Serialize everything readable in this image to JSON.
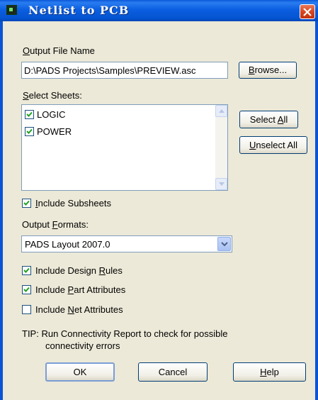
{
  "window": {
    "title": "Netlist to PCB"
  },
  "output_file": {
    "label_prefix": "",
    "label_accel": "O",
    "label_rest": "utput File Name",
    "value": "D:\\PADS Projects\\Samples\\PREVIEW.asc",
    "browse_accel": "B",
    "browse_rest": "rowse..."
  },
  "sheets": {
    "label_accel": "S",
    "label_rest": "elect Sheets:",
    "items": [
      {
        "label": "LOGIC",
        "checked": true
      },
      {
        "label": "POWER",
        "checked": true
      }
    ],
    "select_all_prefix": "Select ",
    "select_all_accel": "A",
    "select_all_rest": "ll",
    "unselect_all_accel": "U",
    "unselect_all_rest": "nselect All"
  },
  "include_subsheets": {
    "accel": "I",
    "rest": "nclude Subsheets",
    "checked": true
  },
  "output_formats": {
    "label_prefix": "Output ",
    "label_accel": "F",
    "label_rest": "ormats:",
    "selected": "PADS Layout 2007.0"
  },
  "options": {
    "design_rules": {
      "prefix": "Include Design ",
      "accel": "R",
      "rest": "ules",
      "checked": true
    },
    "part_attributes": {
      "prefix": "Include ",
      "accel": "P",
      "rest": "art Attributes",
      "checked": true
    },
    "net_attributes": {
      "prefix": "Include ",
      "accel": "N",
      "rest": "et Attributes",
      "checked": false
    }
  },
  "tip": {
    "line1": "TIP: Run Connectivity Report to check for possible",
    "line2": "connectivity errors"
  },
  "buttons": {
    "ok": "OK",
    "cancel": "Cancel",
    "help_accel": "H",
    "help_rest": "elp"
  },
  "icons": {
    "app": "netlist-app-icon",
    "close": "close-icon",
    "check": "checkmark-icon",
    "arrow_up": "scroll-up-arrow-icon",
    "arrow_down": "chevron-down-icon"
  },
  "colors": {
    "titlebar": "#0a55d5",
    "dialog_bg": "#ece9d8",
    "close": "#d6441d",
    "check": "#21a121"
  }
}
